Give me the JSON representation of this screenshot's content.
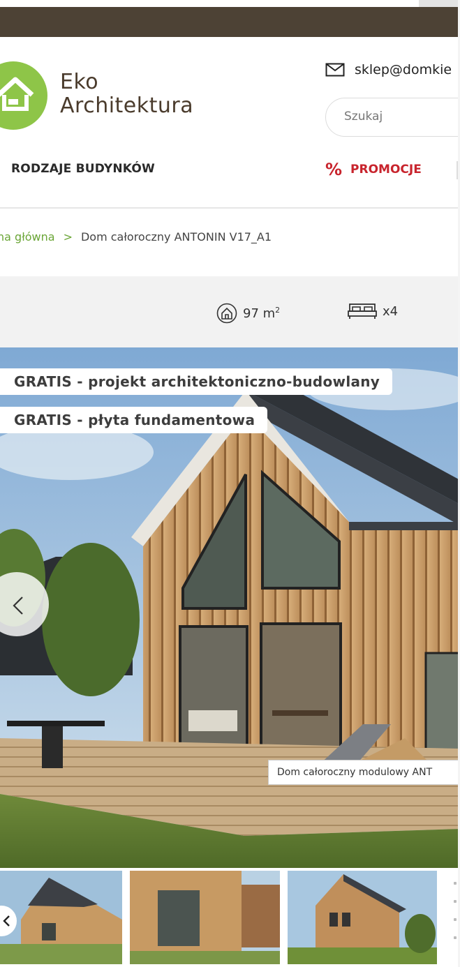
{
  "brand": {
    "line1": "Eko",
    "line2": "Architektura",
    "logo_icon": "house-hand-icon",
    "accent": "#8ec548"
  },
  "header": {
    "email": "sklep@domkie",
    "email_icon": "envelope-icon",
    "search_placeholder": "Szukaj"
  },
  "nav": {
    "types_label": "RODZAJE BUDYNKÓW",
    "promo_symbol": "%",
    "promo_label": "PROMOCJE",
    "promo_color": "#c8242d"
  },
  "breadcrumb": {
    "home": "na główna",
    "separator": ">",
    "current": "Dom całoroczny ANTONIN V17_A1"
  },
  "specs": {
    "area_value": "97 m",
    "area_sup": "2",
    "area_icon": "house-outline-icon",
    "beds_value": "x4",
    "beds_icon": "bed-icon"
  },
  "gallery": {
    "badges": [
      "GRATIS - projekt architektoniczno-budowlany",
      "GRATIS - płyta fundamentowa"
    ],
    "caption": "Dom całoroczny modulowy ANT",
    "prev_icon": "chevron-left-icon"
  },
  "colors": {
    "topbar": "#4d4235",
    "link_green": "#6aa536"
  }
}
